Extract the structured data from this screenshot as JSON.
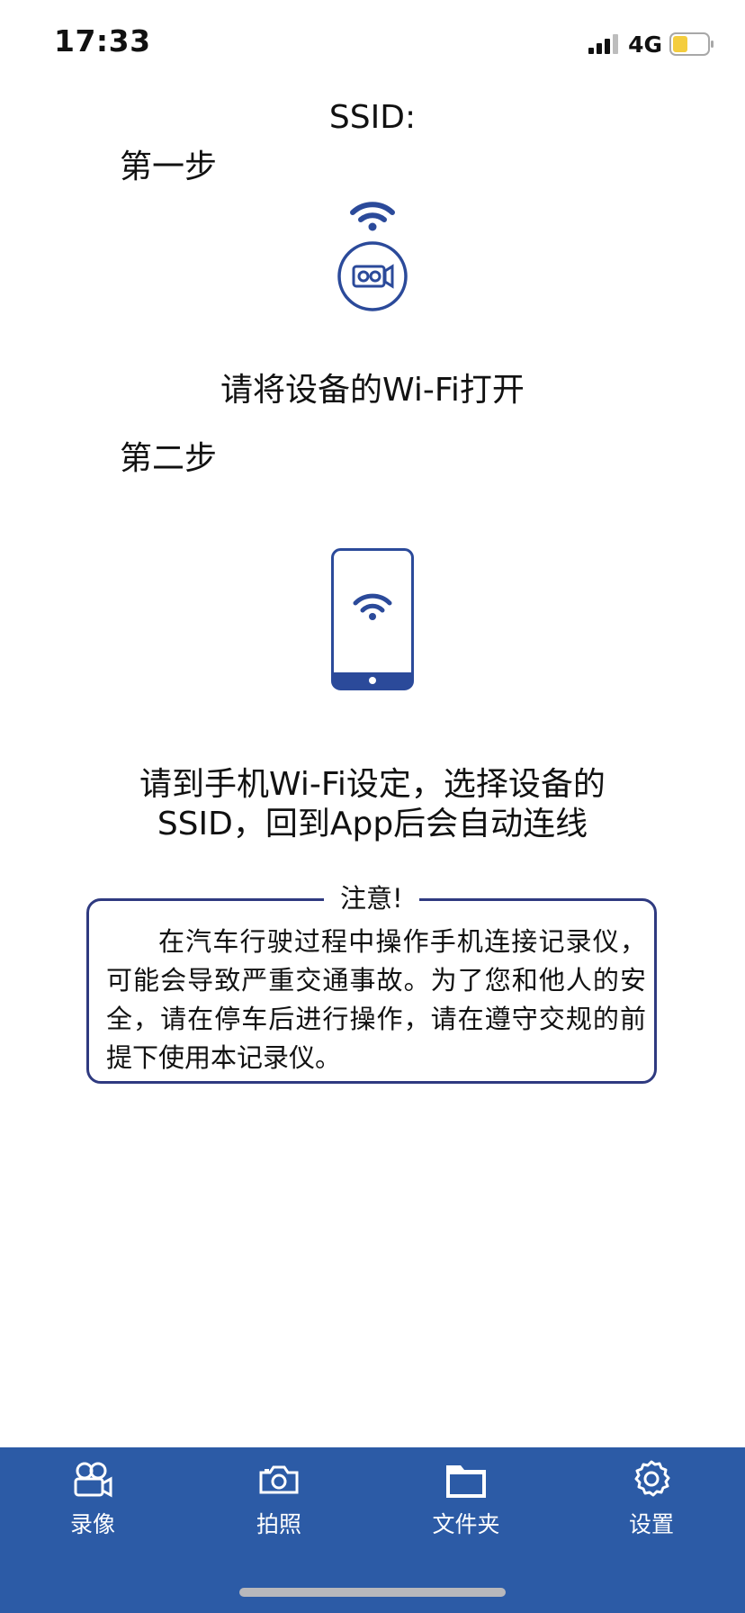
{
  "status_bar": {
    "time": "17:33",
    "network": "4G",
    "battery_color": "#f4cd3e"
  },
  "ssid": {
    "label": "SSID:"
  },
  "step1": {
    "label": "第一步",
    "instruction": "请将设备的Wi-Fi打开",
    "icon": "wifi-camera-icon"
  },
  "step2": {
    "label": "第二步",
    "instruction_line1": "请到手机Wi-Fi设定，选择设备的",
    "instruction_line2": "SSID，回到App后会自动连线",
    "icon": "phone-wifi-icon"
  },
  "notice": {
    "title": "注意!",
    "body": "在汽车行驶过程中操作手机连接记录仪，可能会导致严重交通事故。为了您和他人的安全，请在停车后进行操作，请在遵守交规的前提下使用本记录仪。"
  },
  "tabs": [
    {
      "label": "录像",
      "icon": "video-camera-icon"
    },
    {
      "label": "拍照",
      "icon": "camera-icon"
    },
    {
      "label": "文件夹",
      "icon": "folder-icon"
    },
    {
      "label": "设置",
      "icon": "gear-icon"
    }
  ],
  "colors": {
    "accent": "#2c5ba6",
    "icon_blue": "#2b4a9a",
    "notice_border": "#2f3a80"
  }
}
